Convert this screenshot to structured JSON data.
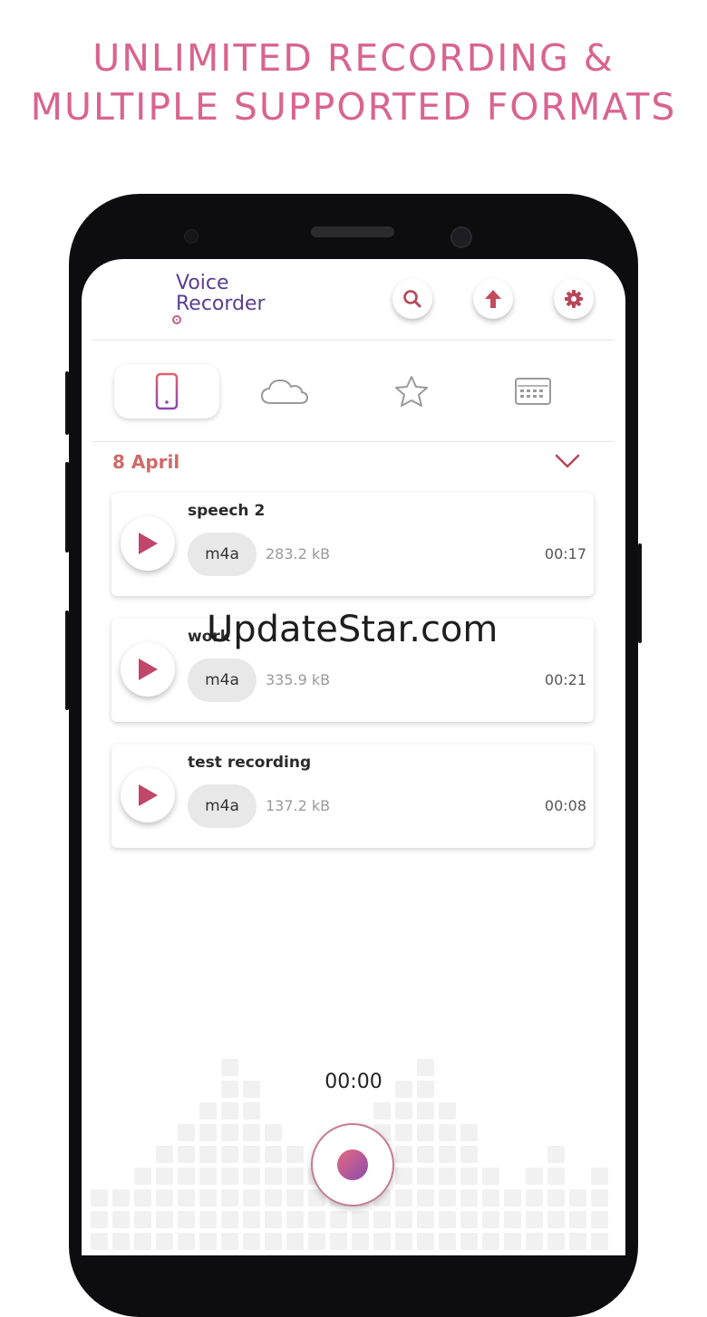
{
  "headline": {
    "line1": "UNLIMITED RECORDING &",
    "line2": "MULTIPLE SUPPORTED FORMATS"
  },
  "app": {
    "logo_line1": "Voice",
    "logo_line2": "Recorder",
    "header_buttons": [
      "search-icon",
      "upload-arrow-icon",
      "gear-icon"
    ],
    "tabs": [
      {
        "icon": "phone-icon",
        "active": true
      },
      {
        "icon": "cloud-icon",
        "active": false
      },
      {
        "icon": "star-icon",
        "active": false
      },
      {
        "icon": "keyboard-icon",
        "active": false
      }
    ]
  },
  "group": {
    "date": "8 April",
    "recordings": [
      {
        "title": "speech 2",
        "format": "m4a",
        "size": "283.2 kB",
        "duration": "00:17"
      },
      {
        "title": "work",
        "format": "m4a",
        "size": "335.9 kB",
        "duration": "00:21"
      },
      {
        "title": "test recording",
        "format": "m4a",
        "size": "137.2 kB",
        "duration": "00:08"
      }
    ]
  },
  "watermark": "UpdateStar.com",
  "recorder": {
    "timer": "00:00"
  },
  "colors": {
    "headline": "#d9648f",
    "accent_red": "#d06a6a",
    "logo_purple": "#5a3f8f",
    "record_gradient_start": "#e66b7e",
    "record_gradient_end": "#8a4bb0"
  }
}
